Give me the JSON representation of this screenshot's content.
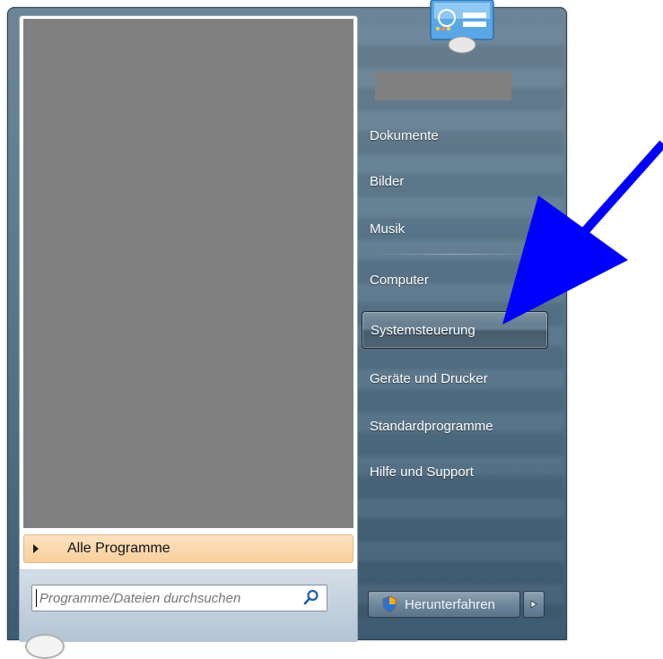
{
  "left_pane": {
    "all_programs_label": "Alle Programme",
    "search_placeholder": "Programme/Dateien durchsuchen"
  },
  "right_pane": {
    "items": [
      {
        "label": "Dokumente"
      },
      {
        "label": "Bilder"
      },
      {
        "label": "Musik"
      },
      {
        "label": "Computer"
      },
      {
        "label": "Systemsteuerung",
        "highlighted": true
      },
      {
        "label": "Geräte und Drucker"
      },
      {
        "label": "Standardprogramme"
      },
      {
        "label": "Hilfe und Support"
      }
    ],
    "shutdown_label": "Herunterfahren"
  },
  "icons": {
    "search": "search-icon",
    "shield": "uac-shield-icon",
    "arrow_right": "arrow-right-icon",
    "user_tile": "user-tile-icon",
    "annotation": "blue-arrow-annotation"
  },
  "colors": {
    "annotation_arrow": "#0000ff",
    "menu_background": "#5f7b90",
    "all_programs_bg": "#f9cf9c",
    "redacted": "#808080"
  }
}
